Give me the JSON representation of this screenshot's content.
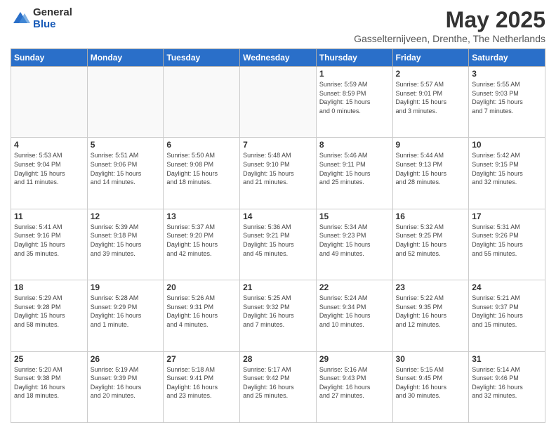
{
  "header": {
    "logo_general": "General",
    "logo_blue": "Blue",
    "month_title": "May 2025",
    "location": "Gasselternijveen, Drenthe, The Netherlands"
  },
  "weekdays": [
    "Sunday",
    "Monday",
    "Tuesday",
    "Wednesday",
    "Thursday",
    "Friday",
    "Saturday"
  ],
  "weeks": [
    [
      {
        "day": "",
        "info": ""
      },
      {
        "day": "",
        "info": ""
      },
      {
        "day": "",
        "info": ""
      },
      {
        "day": "",
        "info": ""
      },
      {
        "day": "1",
        "info": "Sunrise: 5:59 AM\nSunset: 8:59 PM\nDaylight: 15 hours\nand 0 minutes."
      },
      {
        "day": "2",
        "info": "Sunrise: 5:57 AM\nSunset: 9:01 PM\nDaylight: 15 hours\nand 3 minutes."
      },
      {
        "day": "3",
        "info": "Sunrise: 5:55 AM\nSunset: 9:03 PM\nDaylight: 15 hours\nand 7 minutes."
      }
    ],
    [
      {
        "day": "4",
        "info": "Sunrise: 5:53 AM\nSunset: 9:04 PM\nDaylight: 15 hours\nand 11 minutes."
      },
      {
        "day": "5",
        "info": "Sunrise: 5:51 AM\nSunset: 9:06 PM\nDaylight: 15 hours\nand 14 minutes."
      },
      {
        "day": "6",
        "info": "Sunrise: 5:50 AM\nSunset: 9:08 PM\nDaylight: 15 hours\nand 18 minutes."
      },
      {
        "day": "7",
        "info": "Sunrise: 5:48 AM\nSunset: 9:10 PM\nDaylight: 15 hours\nand 21 minutes."
      },
      {
        "day": "8",
        "info": "Sunrise: 5:46 AM\nSunset: 9:11 PM\nDaylight: 15 hours\nand 25 minutes."
      },
      {
        "day": "9",
        "info": "Sunrise: 5:44 AM\nSunset: 9:13 PM\nDaylight: 15 hours\nand 28 minutes."
      },
      {
        "day": "10",
        "info": "Sunrise: 5:42 AM\nSunset: 9:15 PM\nDaylight: 15 hours\nand 32 minutes."
      }
    ],
    [
      {
        "day": "11",
        "info": "Sunrise: 5:41 AM\nSunset: 9:16 PM\nDaylight: 15 hours\nand 35 minutes."
      },
      {
        "day": "12",
        "info": "Sunrise: 5:39 AM\nSunset: 9:18 PM\nDaylight: 15 hours\nand 39 minutes."
      },
      {
        "day": "13",
        "info": "Sunrise: 5:37 AM\nSunset: 9:20 PM\nDaylight: 15 hours\nand 42 minutes."
      },
      {
        "day": "14",
        "info": "Sunrise: 5:36 AM\nSunset: 9:21 PM\nDaylight: 15 hours\nand 45 minutes."
      },
      {
        "day": "15",
        "info": "Sunrise: 5:34 AM\nSunset: 9:23 PM\nDaylight: 15 hours\nand 49 minutes."
      },
      {
        "day": "16",
        "info": "Sunrise: 5:32 AM\nSunset: 9:25 PM\nDaylight: 15 hours\nand 52 minutes."
      },
      {
        "day": "17",
        "info": "Sunrise: 5:31 AM\nSunset: 9:26 PM\nDaylight: 15 hours\nand 55 minutes."
      }
    ],
    [
      {
        "day": "18",
        "info": "Sunrise: 5:29 AM\nSunset: 9:28 PM\nDaylight: 15 hours\nand 58 minutes."
      },
      {
        "day": "19",
        "info": "Sunrise: 5:28 AM\nSunset: 9:29 PM\nDaylight: 16 hours\nand 1 minute."
      },
      {
        "day": "20",
        "info": "Sunrise: 5:26 AM\nSunset: 9:31 PM\nDaylight: 16 hours\nand 4 minutes."
      },
      {
        "day": "21",
        "info": "Sunrise: 5:25 AM\nSunset: 9:32 PM\nDaylight: 16 hours\nand 7 minutes."
      },
      {
        "day": "22",
        "info": "Sunrise: 5:24 AM\nSunset: 9:34 PM\nDaylight: 16 hours\nand 10 minutes."
      },
      {
        "day": "23",
        "info": "Sunrise: 5:22 AM\nSunset: 9:35 PM\nDaylight: 16 hours\nand 12 minutes."
      },
      {
        "day": "24",
        "info": "Sunrise: 5:21 AM\nSunset: 9:37 PM\nDaylight: 16 hours\nand 15 minutes."
      }
    ],
    [
      {
        "day": "25",
        "info": "Sunrise: 5:20 AM\nSunset: 9:38 PM\nDaylight: 16 hours\nand 18 minutes."
      },
      {
        "day": "26",
        "info": "Sunrise: 5:19 AM\nSunset: 9:39 PM\nDaylight: 16 hours\nand 20 minutes."
      },
      {
        "day": "27",
        "info": "Sunrise: 5:18 AM\nSunset: 9:41 PM\nDaylight: 16 hours\nand 23 minutes."
      },
      {
        "day": "28",
        "info": "Sunrise: 5:17 AM\nSunset: 9:42 PM\nDaylight: 16 hours\nand 25 minutes."
      },
      {
        "day": "29",
        "info": "Sunrise: 5:16 AM\nSunset: 9:43 PM\nDaylight: 16 hours\nand 27 minutes."
      },
      {
        "day": "30",
        "info": "Sunrise: 5:15 AM\nSunset: 9:45 PM\nDaylight: 16 hours\nand 30 minutes."
      },
      {
        "day": "31",
        "info": "Sunrise: 5:14 AM\nSunset: 9:46 PM\nDaylight: 16 hours\nand 32 minutes."
      }
    ]
  ]
}
